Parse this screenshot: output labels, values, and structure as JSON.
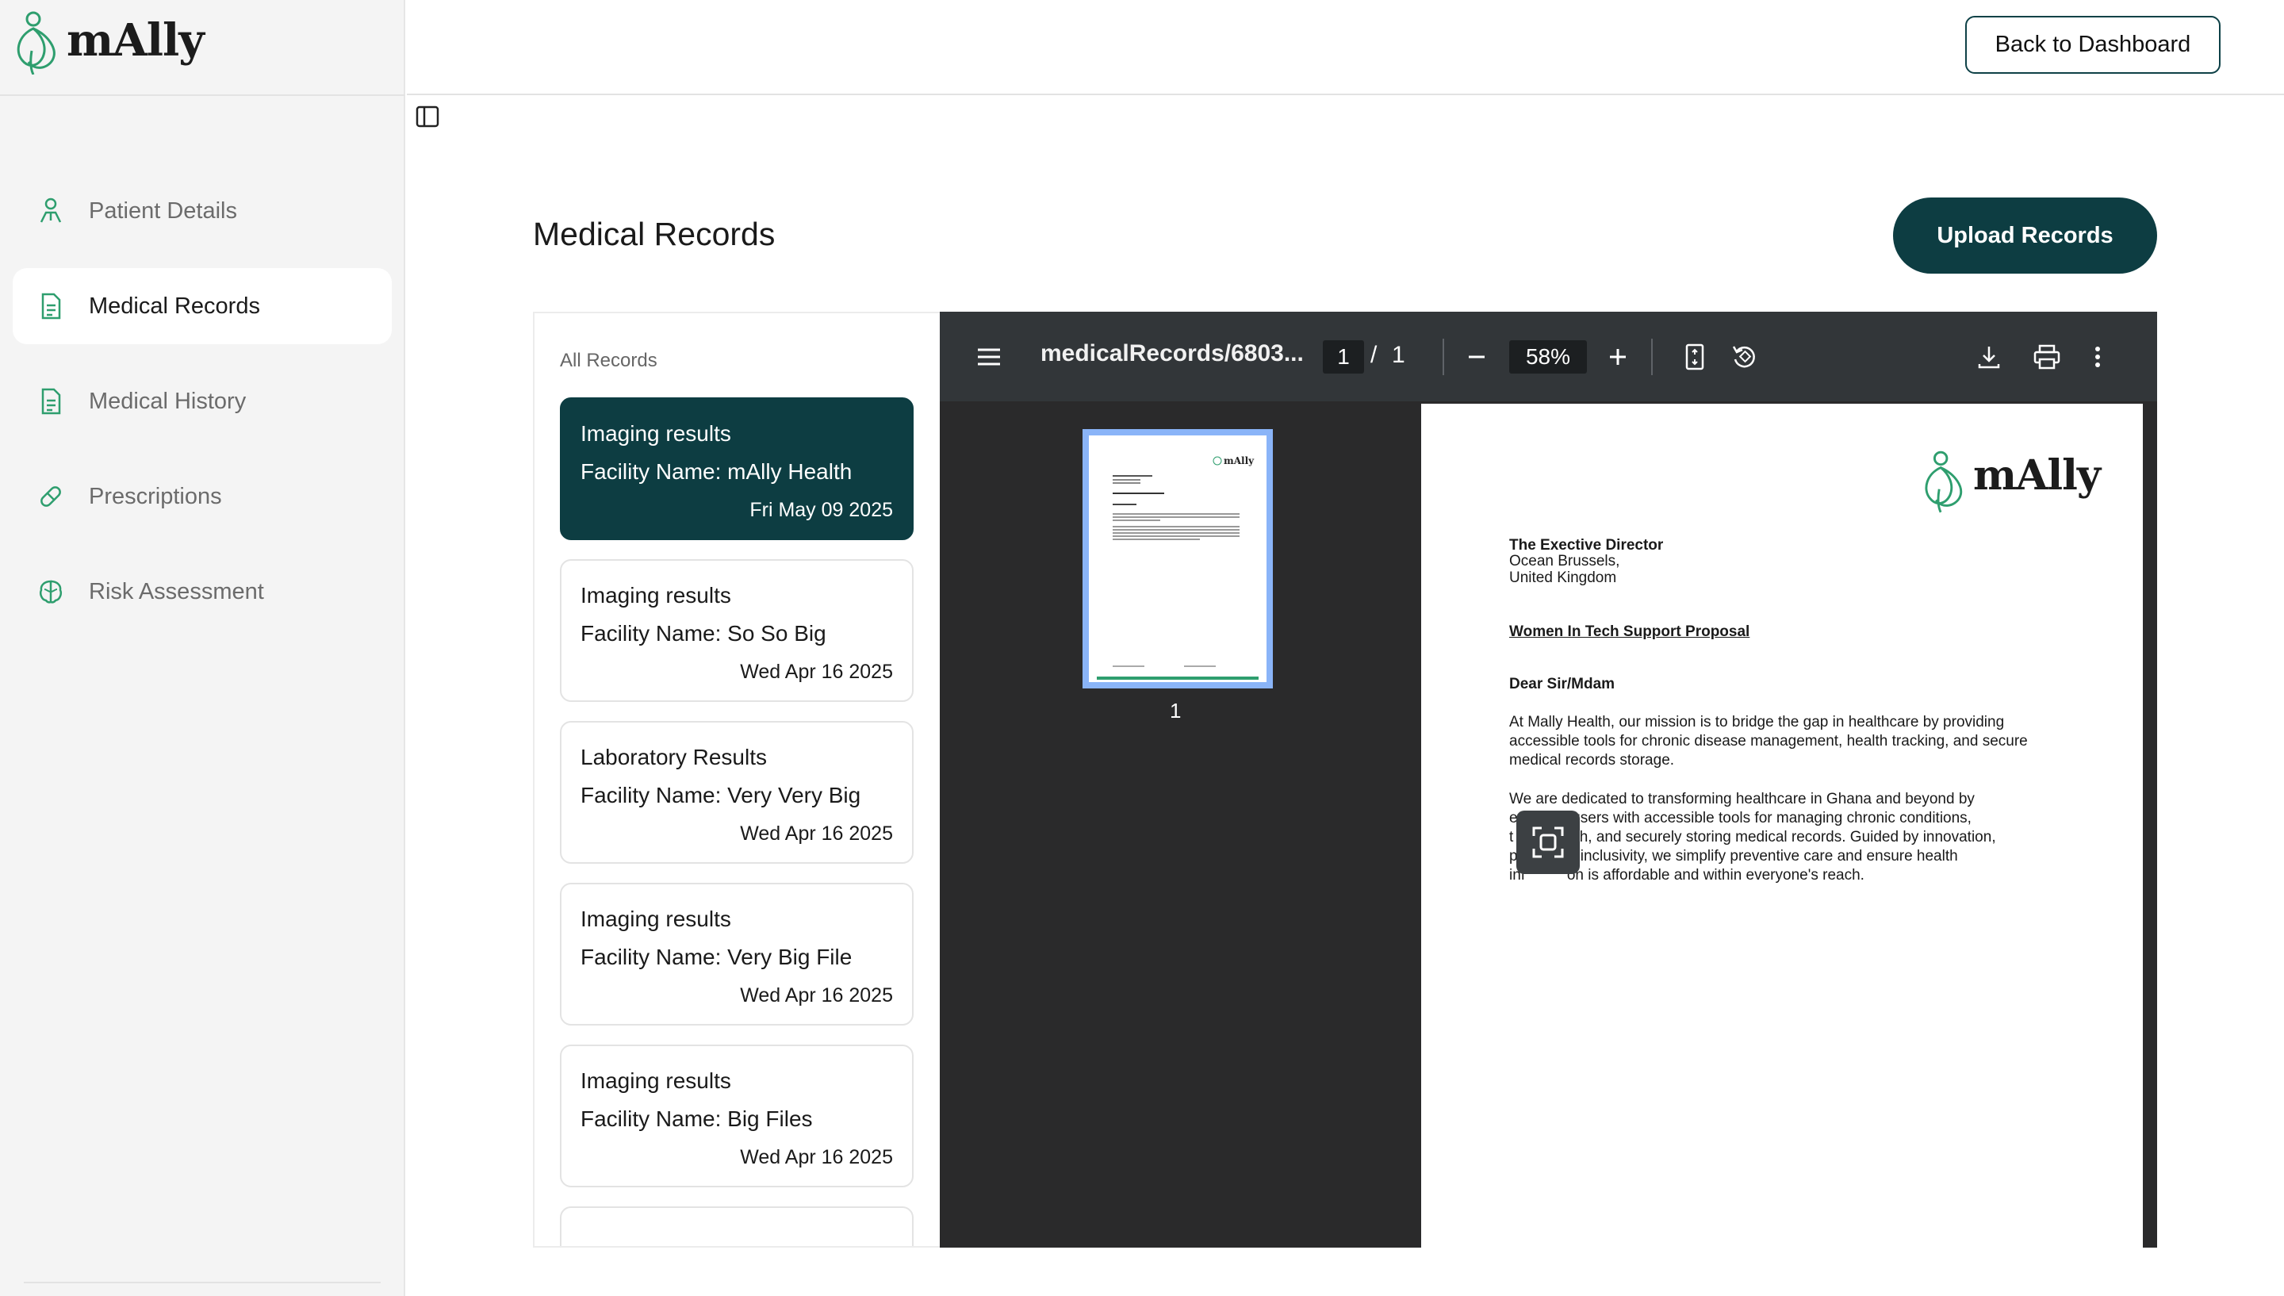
{
  "app": {
    "logo_text": "mAlly"
  },
  "sidebar": {
    "items": [
      {
        "label": "Patient Details",
        "icon": "person-icon",
        "active": false
      },
      {
        "label": "Medical Records",
        "icon": "document-icon",
        "active": true
      },
      {
        "label": "Medical History",
        "icon": "document-icon",
        "active": false
      },
      {
        "label": "Prescriptions",
        "icon": "pill-icon",
        "active": false
      },
      {
        "label": "Risk Assessment",
        "icon": "brain-icon",
        "active": false
      }
    ]
  },
  "header": {
    "back_label": "Back to Dashboard"
  },
  "main": {
    "title": "Medical Records",
    "upload_label": "Upload Records",
    "records_heading": "All Records",
    "records": [
      {
        "type": "Imaging results",
        "facility": "Facility Name: mAlly Health",
        "date": "Fri May 09 2025"
      },
      {
        "type": "Imaging results",
        "facility": "Facility Name: So So Big",
        "date": "Wed Apr 16 2025"
      },
      {
        "type": "Laboratory Results",
        "facility": "Facility Name: Very Very Big",
        "date": "Wed Apr 16 2025"
      },
      {
        "type": "Imaging results",
        "facility": "Facility Name: Very Big File",
        "date": "Wed Apr 16 2025"
      },
      {
        "type": "Imaging results",
        "facility": "Facility Name: Big Files",
        "date": "Wed Apr 16 2025"
      }
    ]
  },
  "viewer": {
    "file_title": "medicalRecords/6803...",
    "page_current": "1",
    "page_sep": "/",
    "page_total": "1",
    "zoom": "58%",
    "thumb_number": "1",
    "document": {
      "logo_text": "mAlly",
      "recipient_title": "The Exective Director",
      "address_line1": "Ocean Brussels,",
      "address_line2": "United Kingdom",
      "subject": "Women In Tech Support Proposal",
      "salutation": "Dear Sir/Mdam",
      "p1_l1": "At Mally Health, our mission is to bridge the gap in healthcare by providing",
      "p1_l2": "accessible tools for chronic disease management, health tracking, and secure",
      "p1_l3": "medical records storage.",
      "p2_l1": "We are dedicated to transforming healthcare in Ghana and beyond by",
      "p2_l2": "e          g users with accessible tools for managing chronic conditions,",
      "p2_l3": "t          ealth, and securely storing medical records. Guided by innovation,",
      "p2_l4": "p          nd inclusivity, we simplify preventive care and ensure health",
      "p2_l5": "inf          on is affordable and within everyone's reach."
    }
  },
  "colors": {
    "brand": "#0d3d42",
    "accent_green": "#2e9e6e",
    "viewer_bg": "#2a2a2b",
    "toolbar_bg": "#323639"
  }
}
